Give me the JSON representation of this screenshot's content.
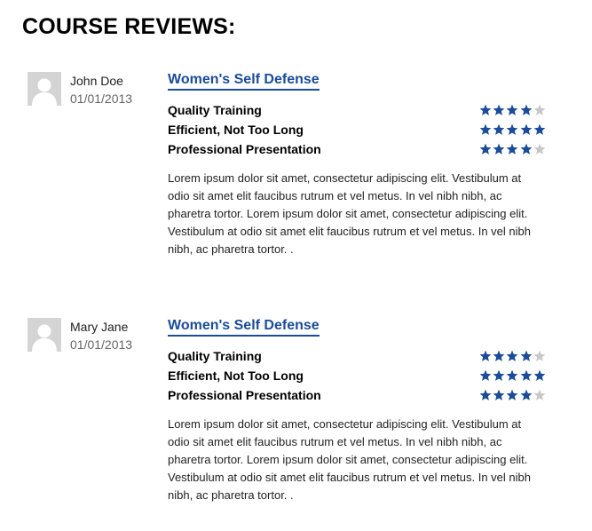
{
  "page": {
    "title": "COURSE REVIEWS:"
  },
  "colors": {
    "star_filled": "#1a4c9a",
    "star_empty": "#c8c8c8",
    "link": "#1a4c9a"
  },
  "reviews": [
    {
      "name": "John Doe",
      "date": "01/01/2013",
      "course": "Women's Self Defense",
      "criteria": [
        {
          "label": "Quality Training",
          "rating": 4,
          "max": 5
        },
        {
          "label": "Efficient, Not Too Long",
          "rating": 5,
          "max": 5
        },
        {
          "label": "Professional Presentation",
          "rating": 4,
          "max": 5
        }
      ],
      "text": "Lorem ipsum dolor sit amet, consectetur adipiscing elit. Vestibulum at odio sit amet elit faucibus rutrum et vel metus. In vel nibh nibh, ac pharetra tortor. Lorem ipsum dolor sit amet, consectetur adipiscing elit. Vestibulum at odio sit amet elit faucibus rutrum et vel metus. In vel nibh nibh, ac pharetra tortor. ."
    },
    {
      "name": "Mary Jane",
      "date": "01/01/2013",
      "course": "Women's Self Defense",
      "criteria": [
        {
          "label": "Quality Training",
          "rating": 4,
          "max": 5
        },
        {
          "label": "Efficient, Not Too Long",
          "rating": 5,
          "max": 5
        },
        {
          "label": "Professional Presentation",
          "rating": 4,
          "max": 5
        }
      ],
      "text": "Lorem ipsum dolor sit amet, consectetur adipiscing elit. Vestibulum at odio sit amet elit faucibus rutrum et vel metus. In vel nibh nibh, ac pharetra tortor. Lorem ipsum dolor sit amet, consectetur adipiscing elit. Vestibulum at odio sit amet elit faucibus rutrum et vel metus. In vel nibh nibh, ac pharetra tortor. ."
    }
  ]
}
